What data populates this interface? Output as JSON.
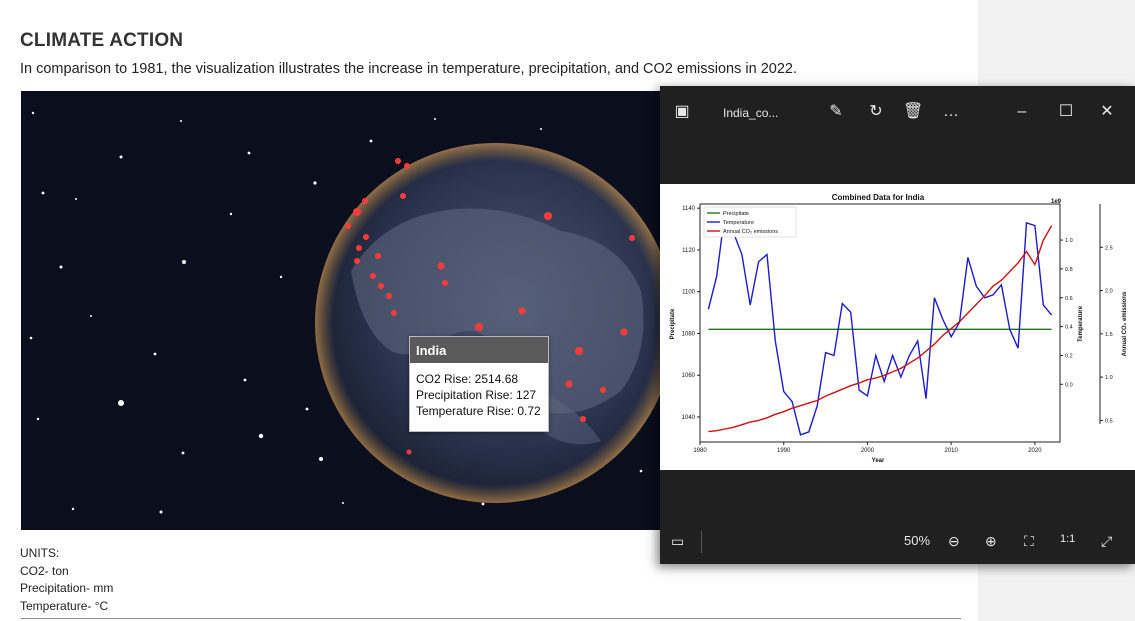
{
  "page": {
    "title": "CLIMATE ACTION",
    "subtitle": "In comparison to 1981, the visualization illustrates the increase in temperature, precipitation, and CO2 emissions in 2022."
  },
  "tooltip": {
    "country": "India",
    "co2": "CO2 Rise: 2514.68",
    "precip": "Precipitation Rise: 127",
    "temp": "Temperature Rise: 0.72"
  },
  "units": {
    "heading": "UNITS:",
    "co2": "CO2- ton",
    "precip": "Precipitation- mm",
    "temp": "Temperature- °C"
  },
  "viewer": {
    "filename": "India_co...",
    "zoom": "50%",
    "icons": [
      "image-app-icon",
      "edit-icon",
      "rotate-icon",
      "delete-icon",
      "more-icon",
      "minimize-icon",
      "maximize-icon",
      "close-icon"
    ]
  },
  "colors": {
    "precip": "#1a7a1a",
    "temp": "#1c1cc8",
    "co2": "#cc1111",
    "marker": "#ff3b3b"
  },
  "chart_data": {
    "type": "line",
    "title": "Combined Data for India",
    "xlabel": "Year",
    "ylabel": "Precipitate",
    "ylabel2": "Temperature",
    "ylabel3": "Annual CO₂ emissions",
    "offset_label": "1e9",
    "xlim": [
      1980,
      2023
    ],
    "ylim": [
      1028,
      1142
    ],
    "y2lim": [
      -0.4,
      1.25
    ],
    "y3lim": [
      0.25,
      3.0
    ],
    "xticks": [
      "1980",
      "1990",
      "2000",
      "2010",
      "2020"
    ],
    "yticks": [
      "1040",
      "1060",
      "1080",
      "1100",
      "1120",
      "1140"
    ],
    "y2ticks": [
      "0.0",
      "0.2",
      "0.4",
      "0.6",
      "0.8",
      "1.0"
    ],
    "y3ticks": [
      "0.5",
      "1.0",
      "1.5",
      "2.0",
      "2.5"
    ],
    "legend": [
      "Precipitate",
      "Temperature",
      "Annual CO₂ emissions"
    ],
    "legend_position": "top-left",
    "series": [
      {
        "name": "Precipitate",
        "axis": "left",
        "x": [
          1981,
          2022
        ],
        "values": [
          1082,
          1082
        ]
      },
      {
        "name": "Temperature",
        "axis": "right",
        "x": [
          1981,
          1982,
          1983,
          1984,
          1985,
          1986,
          1987,
          1988,
          1989,
          1990,
          1991,
          1992,
          1993,
          1994,
          1995,
          1996,
          1997,
          1998,
          1999,
          2000,
          2001,
          2002,
          2003,
          2004,
          2005,
          2006,
          2007,
          2008,
          2009,
          2010,
          2011,
          2012,
          2013,
          2014,
          2015,
          2016,
          2017,
          2018,
          2019,
          2020,
          2021,
          2022
        ],
        "values": [
          0.52,
          0.75,
          1.2,
          1.05,
          0.9,
          0.55,
          0.85,
          0.9,
          0.3,
          -0.05,
          -0.12,
          -0.35,
          -0.33,
          -0.15,
          0.22,
          0.2,
          0.56,
          0.5,
          -0.04,
          -0.08,
          0.2,
          0.02,
          0.2,
          0.05,
          0.2,
          0.3,
          -0.1,
          0.6,
          0.45,
          0.33,
          0.43,
          0.88,
          0.68,
          0.6,
          0.62,
          0.69,
          0.38,
          0.25,
          1.12,
          1.1,
          0.55,
          0.48
        ]
      },
      {
        "name": "Annual CO₂ emissions",
        "axis": "right2",
        "x": [
          1981,
          1982,
          1983,
          1984,
          1985,
          1986,
          1987,
          1988,
          1989,
          1990,
          1991,
          1992,
          1993,
          1994,
          1995,
          1996,
          1997,
          1998,
          1999,
          2000,
          2001,
          2002,
          2003,
          2004,
          2005,
          2006,
          2007,
          2008,
          2009,
          2010,
          2011,
          2012,
          2013,
          2014,
          2015,
          2016,
          2017,
          2018,
          2019,
          2020,
          2021,
          2022
        ],
        "values": [
          0.37,
          0.38,
          0.4,
          0.42,
          0.45,
          0.48,
          0.5,
          0.53,
          0.57,
          0.6,
          0.64,
          0.67,
          0.7,
          0.73,
          0.78,
          0.82,
          0.86,
          0.9,
          0.93,
          0.97,
          0.99,
          1.02,
          1.06,
          1.1,
          1.16,
          1.22,
          1.3,
          1.38,
          1.48,
          1.56,
          1.64,
          1.74,
          1.84,
          1.94,
          2.05,
          2.12,
          2.22,
          2.32,
          2.45,
          2.3,
          2.58,
          2.75
        ]
      }
    ]
  }
}
